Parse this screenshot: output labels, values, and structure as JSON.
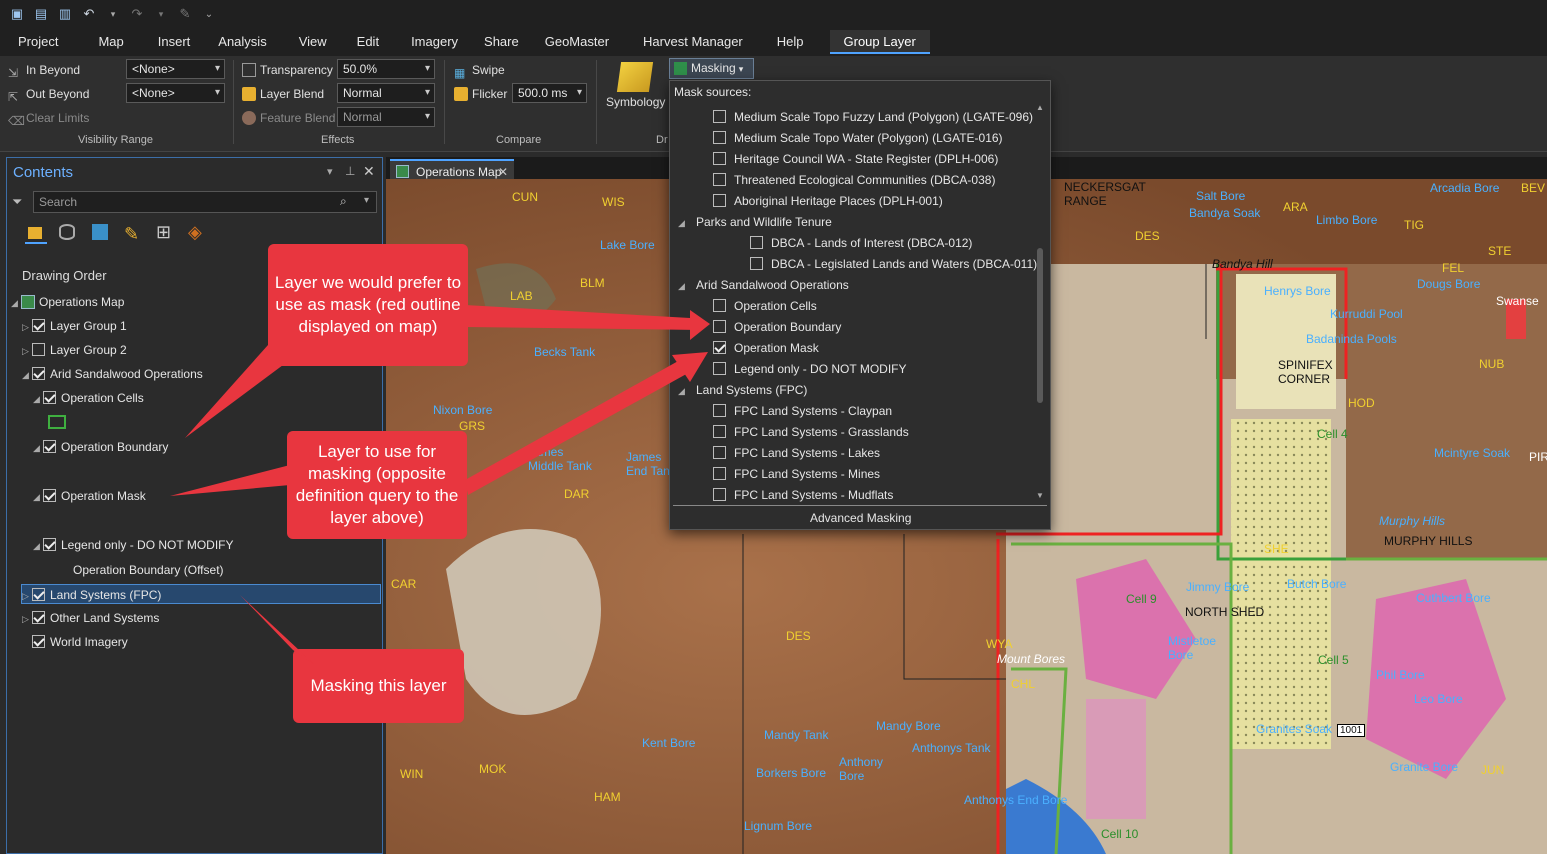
{
  "ribbon_tabs": [
    "Project",
    "Map",
    "Insert",
    "Analysis",
    "View",
    "Edit",
    "Imagery",
    "Share",
    "GeoMaster",
    "Harvest Manager",
    "Help",
    "Group Layer"
  ],
  "ribbon": {
    "in_beyond": "In Beyond",
    "out_beyond": "Out Beyond",
    "clear_limits": "Clear Limits",
    "in_beyond_value": "<None>",
    "out_beyond_value": "<None>",
    "visibility_range": "Visibility Range",
    "transparency": "Transparency",
    "transparency_value": "50.0%",
    "layer_blend": "Layer Blend",
    "layer_blend_value": "Normal",
    "feature_blend": "Feature Blend",
    "feature_blend_value": "Normal",
    "effects": "Effects",
    "swipe": "Swipe",
    "flicker": "Flicker",
    "flicker_value": "500.0  ms",
    "compare": "Compare",
    "symbology": "Symbology",
    "drawing_truncated": "Dr",
    "masking": "Masking"
  },
  "contents": {
    "title": "Contents",
    "search_placeholder": "Search",
    "drawing_order": "Drawing Order",
    "items": [
      {
        "label": "Operations Map"
      },
      {
        "label": "Layer Group 1"
      },
      {
        "label": "Layer Group 2"
      },
      {
        "label": "Arid Sandalwood Operations"
      },
      {
        "label": "Operation Cells"
      },
      {
        "label": "Operation Boundary"
      },
      {
        "label": "Operation Mask"
      },
      {
        "label": "Legend only - DO NOT MODIFY"
      },
      {
        "label": "Operation Boundary (Offset)"
      },
      {
        "label": "Land Systems (FPC)"
      },
      {
        "label": "Other Land Systems"
      },
      {
        "label": "World Imagery"
      }
    ]
  },
  "map_tab": "Operations Map",
  "mask_dropdown": {
    "header": "Mask sources:",
    "items": [
      {
        "label": "Medium Scale Topo Fuzzy Land (Polygon) (LGATE-096)",
        "checked": false
      },
      {
        "label": "Medium Scale Topo Water (Polygon) (LGATE-016)",
        "checked": false
      },
      {
        "label": "Heritage Council WA - State Register (DPLH-006)",
        "checked": false
      },
      {
        "label": "Threatened Ecological Communities (DBCA-038)",
        "checked": false
      },
      {
        "label": "Aboriginal Heritage Places (DPLH-001)",
        "checked": false
      },
      {
        "label": "Parks and Wildlife Tenure",
        "group": true
      },
      {
        "label": "DBCA - Lands of Interest (DBCA-012)",
        "checked": false
      },
      {
        "label": "DBCA - Legislated Lands and Waters (DBCA-011)",
        "checked": false
      },
      {
        "label": "Arid Sandalwood Operations",
        "group": true
      },
      {
        "label": "Operation Cells",
        "checked": false
      },
      {
        "label": "Operation Boundary",
        "checked": false
      },
      {
        "label": "Operation Mask",
        "checked": true
      },
      {
        "label": "Legend only - DO NOT MODIFY",
        "checked": false
      },
      {
        "label": "Land Systems (FPC)",
        "group": true
      },
      {
        "label": "FPC Land Systems - Claypan",
        "checked": false
      },
      {
        "label": "FPC Land Systems - Grasslands",
        "checked": false
      },
      {
        "label": "FPC Land Systems - Lakes",
        "checked": false
      },
      {
        "label": "FPC Land Systems - Mines",
        "checked": false
      },
      {
        "label": "FPC Land Systems - Mudflats",
        "checked": false
      }
    ],
    "footer": "Advanced Masking"
  },
  "callouts": {
    "prefer": "Layer we would prefer to use as mask (red outline displayed on map)",
    "use": "Layer to use for masking (opposite definition query to the layer above)",
    "masking": "Masking this layer"
  },
  "map_labels": {
    "neckersgat": "NECKERSGAT\nRANGE",
    "salt_bore": "Salt Bore",
    "bandya_soak": "Bandya Soak",
    "limbo_bore": "Limbo Bore",
    "arcadia_bore": "Arcadia Bore",
    "bandya_hill": "Bandya Hill",
    "henrys_bore": "Henrys Bore",
    "kurrudi_pool": "Kurruddi Pool",
    "doug_bore": "Dougs Bore",
    "badaninda": "Badaninda Pools",
    "spinifex": "SPINIFEX\nCORNER",
    "lake_bore": "Lake Bore",
    "becks_tank": "Becks Tank",
    "nixon_bore": "Nixon Bore",
    "james_tank": "James\nMiddle Tank",
    "james_end": "James\nEnd Tank",
    "murphy_hills": "MURPHY HILLS",
    "north_shed": "NORTH SHED",
    "jimmy_bore": "Jimmy Bore",
    "butch_bore": "Butch Bore",
    "cuthbert_bore": "Cuthbert Bore",
    "mistletoe": "Mistletoe\nBore",
    "mount_bores": "Mount Bores",
    "phil_bore": "Phil Bore",
    "leo_bore": "Leo Bore",
    "granites_soak": "Granites Soak",
    "kent_bore": "Kent Bore",
    "mandy_tank": "Mandy Tank",
    "mandy_bore": "Mandy Bore",
    "anthonys_tank": "Anthonys Tank",
    "anthony_bore": "Anthony\nBore",
    "borkers_bore": "Borkers Bore",
    "anthonys_end": "Anthonys End Bore",
    "lignum_bore": "Lignum Bore",
    "mcintyre": "Mcintyre Soak",
    "murphy_italic": "Murphy Hills",
    "granite_bore": "Granite Bore",
    "cell4": "Cell 4",
    "cell5": "Cell 5",
    "cell9": "Cell 9",
    "cell10": "Cell 10",
    "swanse": "Swanse",
    "nub": "NUB",
    "sh_1001": "1001"
  },
  "map_codes": {
    "cun": "CUN",
    "wis": "WIS",
    "blm": "BLM",
    "lab": "LAB",
    "grs": "GRS",
    "dar": "DAR",
    "car": "CAR",
    "win": "WIN",
    "mok": "MOK",
    "ham": "HAM",
    "des": "DES",
    "wya": "WYA",
    "chl": "CHL",
    "jun": "JUN",
    "ara": "ARA",
    "tig": "TIG",
    "ste": "STE",
    "fel": "FEL",
    "bev": "BEV",
    "she": "SHE",
    "hod": "HOD",
    "pir": "PIR"
  }
}
